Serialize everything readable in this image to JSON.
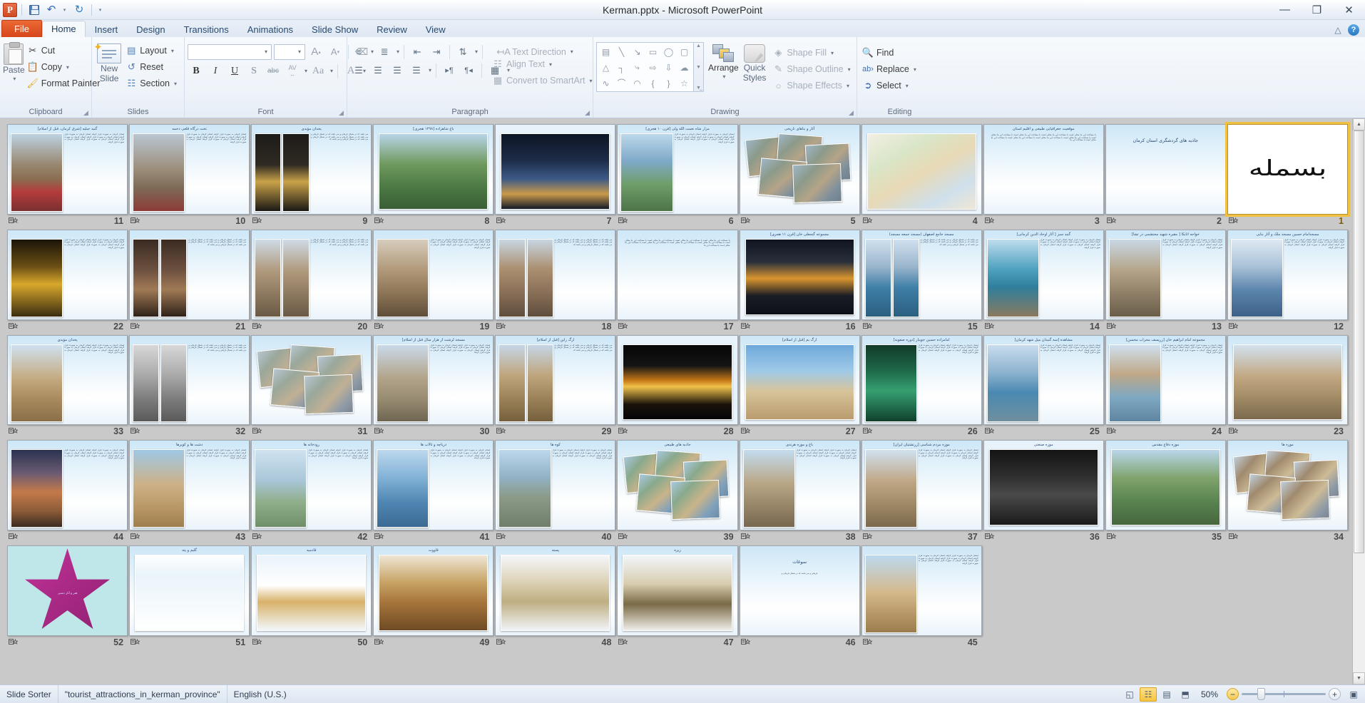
{
  "window": {
    "title": "Kerman.pptx  -  Microsoft PowerPoint",
    "minimize_label": "—",
    "restore_label": "❐",
    "close_label": "✕",
    "app_logo": "P"
  },
  "quick_access": {
    "save": "save-icon",
    "undo": "↶",
    "undo_caret": "▾",
    "redo": "↻",
    "customize": "▾"
  },
  "tabs": [
    {
      "label": "File",
      "active": false,
      "file": true
    },
    {
      "label": "Home",
      "active": true
    },
    {
      "label": "Insert",
      "active": false
    },
    {
      "label": "Design",
      "active": false
    },
    {
      "label": "Transitions",
      "active": false
    },
    {
      "label": "Animations",
      "active": false
    },
    {
      "label": "Slide Show",
      "active": false
    },
    {
      "label": "Review",
      "active": false
    },
    {
      "label": "View",
      "active": false
    }
  ],
  "ribbon": {
    "groups": [
      {
        "name": "Clipboard",
        "label": "Clipboard",
        "launcher": true
      },
      {
        "name": "Slides",
        "label": "Slides",
        "launcher": false
      },
      {
        "name": "Font",
        "label": "Font",
        "launcher": true
      },
      {
        "name": "Paragraph",
        "label": "Paragraph",
        "launcher": true
      },
      {
        "name": "Drawing",
        "label": "Drawing",
        "launcher": true
      },
      {
        "name": "Editing",
        "label": "Editing",
        "launcher": false
      }
    ],
    "clipboard": {
      "paste": "Paste",
      "paste_caret": "▾",
      "cut": "Cut",
      "copy": "Copy",
      "copy_caret": "▾",
      "format_painter": "Format Painter"
    },
    "slides": {
      "new_slide_line1": "New",
      "new_slide_line2": "Slide",
      "new_slide_caret": "▾",
      "layout": "Layout",
      "layout_caret": "▾",
      "reset": "Reset",
      "section": "Section",
      "section_caret": "▾"
    },
    "font": {
      "font_name_value": "",
      "font_size_value": "",
      "grow_font": "A▴",
      "shrink_font": "A▾",
      "clear_formatting": "clear-formatting-icon",
      "bold": "B",
      "italic": "I",
      "underline": "U",
      "shadow": "S",
      "strikethrough": "abc",
      "character_spacing": "AV",
      "change_case": "Aa",
      "font_color": "A"
    },
    "paragraph": {
      "bullets": "bullets-icon",
      "numbering": "numbering-icon",
      "decrease_indent": "decrease-indent-icon",
      "increase_indent": "increase-indent-icon",
      "line_spacing": "line-spacing-icon",
      "align_left": "align-left-icon",
      "align_center": "align-center-icon",
      "align_right": "align-right-icon",
      "justify": "justify-icon",
      "ltr": "▸¶",
      "rtl": "¶◂",
      "columns": "columns-icon",
      "text_direction": "Text Direction",
      "align_text": "Align Text",
      "convert_to_smartart": "Convert to SmartArt"
    },
    "drawing": {
      "shapes": [
        "text-box-shape",
        "line-shape",
        "arrow-shape",
        "rectangle-shape",
        "oval-shape",
        "rounded-rect-shape",
        "triangle-shape",
        "elbow-connector-shape",
        "elbow-arrow-shape",
        "right-arrow-shape",
        "down-arrow-shape",
        "cloud-shape",
        "freeform-shape",
        "curve-shape",
        "arc-shape",
        "left-brace-shape",
        "right-brace-shape",
        "star-shape"
      ],
      "shape_glyphs": [
        "▤",
        "╲",
        "↘",
        "▭",
        "◯",
        "▢",
        "△",
        "┐",
        "⤷",
        "⇨",
        "⇩",
        "☁",
        "∿",
        "⌒",
        "◠",
        "{",
        "}",
        "☆"
      ],
      "arrange": "Arrange",
      "arrange_caret": "▾",
      "quick_styles_line1": "Quick",
      "quick_styles_line2": "Styles",
      "quick_styles_caret": "▾",
      "shape_fill": "Shape Fill",
      "shape_outline": "Shape Outline",
      "shape_effects": "Shape Effects"
    },
    "editing": {
      "find": "Find",
      "replace": "Replace",
      "replace_caret": "▾",
      "select": "Select",
      "select_caret": "▾"
    }
  },
  "status_bar": {
    "view_mode": "Slide Sorter",
    "theme": "\"tourist_attractions_in_kerman_province\"",
    "language": "English (U.S.)",
    "zoom_label": "50%",
    "zoom_value": 50,
    "views": [
      {
        "name": "normal-view-button",
        "glyph": "◱",
        "active": false
      },
      {
        "name": "slide-sorter-view-button",
        "glyph": "☷",
        "active": true
      },
      {
        "name": "reading-view-button",
        "glyph": "▤",
        "active": false
      },
      {
        "name": "slide-show-button",
        "glyph": "⬒",
        "active": false
      }
    ],
    "zoom_out": "−",
    "zoom_in": "+",
    "fit_to_window": "fit-slide-to-window-icon"
  },
  "scrollbar": {
    "up_arrow": "▲",
    "down_arrow": "▼"
  },
  "sorter": {
    "transition_icon_name": "transition-star-icon",
    "columns": 11,
    "rows": 5,
    "slides": [
      {
        "num": 11,
        "title": "گنبد جبلیه [شرق کرمان، قبل از اسلام]",
        "layout": "text-left-image",
        "pic": "monument-flowers",
        "selected": false
      },
      {
        "num": 10,
        "title": "تخت درگاه قلعی دخمه",
        "layout": "text-left-image",
        "pic": "rocky-ruins",
        "selected": false
      },
      {
        "num": 9,
        "title": "یخدان مؤیدی",
        "layout": "text-two-image",
        "pic": "dark-interior",
        "selected": false
      },
      {
        "num": 8,
        "title": "باغ شاهزاده [۱۲۹۸ هجری]",
        "layout": "image-full",
        "pic": "garden-fountain",
        "selected": false
      },
      {
        "num": 7,
        "title": "",
        "layout": "image-full-dark",
        "pic": "night-mosque",
        "selected": false
      },
      {
        "num": 6,
        "title": "مزار شاه نعمت الله ولی [قرن ۱۰ هجری]",
        "layout": "text-left-image",
        "pic": "blue-dome-garden",
        "selected": false
      },
      {
        "num": 5,
        "title": "آثار و بناهای تاریخی",
        "layout": "collage",
        "pic": "historic-collage",
        "selected": false
      },
      {
        "num": 4,
        "title": "",
        "layout": "map",
        "pic": "province-map",
        "selected": false
      },
      {
        "num": 3,
        "title": "موقعیت جغرافیایی طبیعی و اقلیم استان",
        "layout": "text-only",
        "pic": "",
        "selected": false
      },
      {
        "num": 2,
        "title": "جاذبه های گردشگری استان کرمان",
        "layout": "title-only",
        "pic": "",
        "selected": false
      },
      {
        "num": 1,
        "title": "",
        "layout": "calligraphy",
        "pic": "bismillah-calligraphy",
        "selected": true
      },
      {
        "num": 22,
        "title": "",
        "layout": "text-left-image",
        "pic": "golden-hall",
        "selected": false
      },
      {
        "num": 21,
        "title": "",
        "layout": "text-two-image",
        "pic": "museum-interior",
        "selected": false
      },
      {
        "num": 20,
        "title": "",
        "layout": "text-two-image",
        "pic": "arched-corridor",
        "selected": false
      },
      {
        "num": 19,
        "title": "",
        "layout": "text-left-image",
        "pic": "mosque-hall",
        "selected": false
      },
      {
        "num": 18,
        "title": "",
        "layout": "text-two-image",
        "pic": "brick-arches",
        "selected": false
      },
      {
        "num": 17,
        "title": "",
        "layout": "text-only",
        "pic": "",
        "selected": false
      },
      {
        "num": 16,
        "title": "مجموعه گنجعلی خان [قرن ۱۱ هجری]",
        "layout": "image-full",
        "pic": "lit-courtyard",
        "selected": false
      },
      {
        "num": 15,
        "title": "مسجد جامع اصفهان (مسجد جمعه مسجد)",
        "layout": "text-two-image",
        "pic": "tiled-minaret",
        "selected": false
      },
      {
        "num": 14,
        "title": "گنبد سبز [ آثار اوحاد الدین کرمانی]",
        "layout": "text-left-image",
        "pic": "turquoise-dome",
        "selected": false
      },
      {
        "num": 13,
        "title": "خواجه اتابکا [ مقبره شهید محتشمی در تشا]",
        "layout": "text-left-image",
        "pic": "stone-tomb",
        "selected": false
      },
      {
        "num": 12,
        "title": "مسجدامام حسین مسجد ملک و آثار بنایی",
        "layout": "text-left-image",
        "pic": "blue-mihrab",
        "selected": false
      },
      {
        "num": 33,
        "title": "یخدان مؤیدی",
        "layout": "text-left-image",
        "pic": "desert-dome",
        "selected": false
      },
      {
        "num": 32,
        "title": "",
        "layout": "text-two-image",
        "pic": "ruins-bw",
        "selected": false
      },
      {
        "num": 31,
        "title": "",
        "layout": "collage",
        "pic": "site-collage",
        "selected": false
      },
      {
        "num": 30,
        "title": "مسجد لرشت از هزار سال قبل از اسلام]",
        "layout": "text-left-image",
        "pic": "stone-ruins",
        "selected": false
      },
      {
        "num": 29,
        "title": "ارگ راین [قبل از اسلام]",
        "layout": "text-two-image",
        "pic": "mud-arch",
        "selected": false
      },
      {
        "num": 28,
        "title": "",
        "layout": "image-full-dark",
        "pic": "night-citadel",
        "selected": false
      },
      {
        "num": 27,
        "title": "ارگ بم [قبل از اسلام]",
        "layout": "image-full",
        "pic": "sky-citadel",
        "selected": false
      },
      {
        "num": 26,
        "title": "امامزاده حسین جویبار [دوره صفویه]",
        "layout": "text-left-image",
        "pic": "green-tile-interior",
        "selected": false
      },
      {
        "num": 25,
        "title": "مشاهده [سه گنبدان میل شهد کرمان]",
        "layout": "text-left-image",
        "pic": "blue-dome-pool",
        "selected": false
      },
      {
        "num": 24,
        "title": "مجموعه امام ابراهیم خان [زریسف محراب محسن]",
        "layout": "text-left-image",
        "pic": "courtyard-pool",
        "selected": false
      },
      {
        "num": 23,
        "title": "",
        "layout": "image-full",
        "pic": "brick-courtyard",
        "selected": false
      },
      {
        "num": 44,
        "title": "",
        "layout": "text-left-image",
        "pic": "desert-sunset",
        "selected": false
      },
      {
        "num": 43,
        "title": "دشت ها و کویرها",
        "layout": "text-left-image",
        "pic": "sand-dunes",
        "selected": false
      },
      {
        "num": 42,
        "title": "رودخانه ها",
        "layout": "text-left-image",
        "pic": "river-landscape",
        "selected": false
      },
      {
        "num": 41,
        "title": "دریاچه و تالاب ها",
        "layout": "text-left-image",
        "pic": "lake-view",
        "selected": false
      },
      {
        "num": 40,
        "title": "کوه ها",
        "layout": "text-left-image",
        "pic": "mountains",
        "selected": false
      },
      {
        "num": 39,
        "title": "جاذبه های طبیعی",
        "layout": "collage",
        "pic": "nature-collage",
        "selected": false
      },
      {
        "num": 38,
        "title": "باغ و موزه هرندی",
        "layout": "text-left-image",
        "pic": "historic-building",
        "selected": false
      },
      {
        "num": 37,
        "title": "موزه مردم شناسی [زرتشتیان ایران]",
        "layout": "text-left-image",
        "pic": "museum-facade",
        "selected": false
      },
      {
        "num": 36,
        "title": "موزه صنعتی",
        "layout": "image-full-dark",
        "pic": "dark-museum-room",
        "selected": false
      },
      {
        "num": 35,
        "title": "موزه دفاع مقدس",
        "layout": "image-full",
        "pic": "garden-pathway",
        "selected": false
      },
      {
        "num": 34,
        "title": "موزه ها",
        "layout": "collage",
        "pic": "museum-collage",
        "selected": false
      },
      {
        "num": 52,
        "title": "هنر و آثار دستی",
        "layout": "star-shape",
        "pic": "magenta-star",
        "selected": false
      },
      {
        "num": 51,
        "title": "گلیم و پته",
        "layout": "image-full",
        "pic": "red-carpet",
        "selected": false
      },
      {
        "num": 50,
        "title": "قادمیه",
        "layout": "image-full",
        "pic": "tea-glass",
        "selected": false
      },
      {
        "num": 49,
        "title": "قاووت",
        "layout": "image-full",
        "pic": "sweets-tray",
        "selected": false
      },
      {
        "num": 48,
        "title": "پسته",
        "layout": "image-full",
        "pic": "pistachios",
        "selected": false
      },
      {
        "num": 47,
        "title": "زیره",
        "layout": "image-full",
        "pic": "cumin-spice",
        "selected": false
      },
      {
        "num": 46,
        "title": "سوغات",
        "layout": "title-only",
        "pic": "",
        "selected": false
      },
      {
        "num": 45,
        "title": "",
        "layout": "text-left-image",
        "pic": "desert-landscape",
        "selected": false
      }
    ]
  }
}
